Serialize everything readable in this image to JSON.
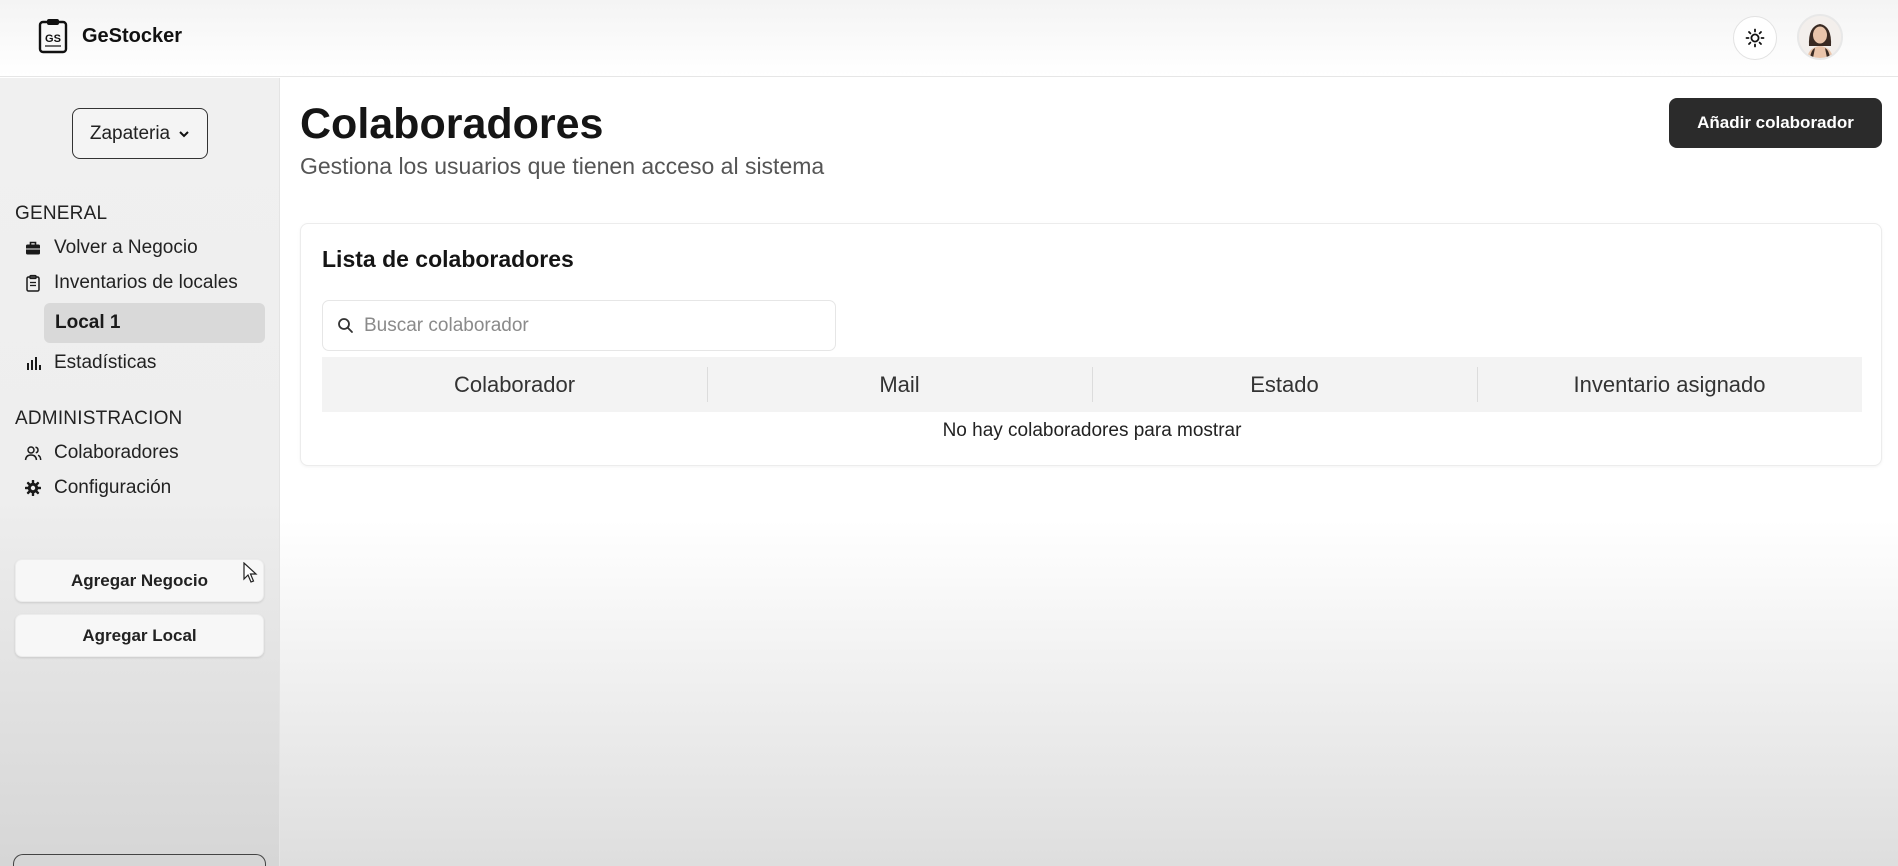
{
  "header": {
    "brand_mark": "GS",
    "brand_name": "GeStocker",
    "theme_toggle_icon": "sun-icon",
    "avatar_icon": "user-avatar"
  },
  "sidebar": {
    "business_select": {
      "selected": "Zapateria",
      "icon": "chevron-down-icon"
    },
    "general_title": "GENERAL",
    "general_items": [
      {
        "label": "Volver a Negocio",
        "icon": "briefcase-icon"
      },
      {
        "label": "Inventarios de locales",
        "icon": "clipboard-icon"
      }
    ],
    "sub_item": {
      "label": "Local 1",
      "active": true
    },
    "stats_item": {
      "label": "Estadísticas",
      "icon": "bar-chart-icon"
    },
    "admin_title": "ADMINISTRACION",
    "admin_items": [
      {
        "label": "Colaboradores",
        "icon": "users-icon"
      },
      {
        "label": "Configuración",
        "icon": "gear-icon"
      }
    ],
    "buttons": {
      "add_business": "Agregar Negocio",
      "add_local": "Agregar Local"
    }
  },
  "main": {
    "title": "Colaboradores",
    "subtitle": "Gestiona los usuarios que tienen acceso al sistema",
    "add_button": "Añadir colaborador",
    "card": {
      "title": "Lista de colaboradores",
      "search_placeholder": "Buscar colaborador",
      "columns": [
        "Colaborador",
        "Mail",
        "Estado",
        "Inventario asignado"
      ],
      "empty_message": "No hay colaboradores para mostrar"
    }
  },
  "colors": {
    "primary_button": "#2b2b2b",
    "sidebar_active": "#d9d9d9",
    "table_header": "#f3f3f3"
  }
}
